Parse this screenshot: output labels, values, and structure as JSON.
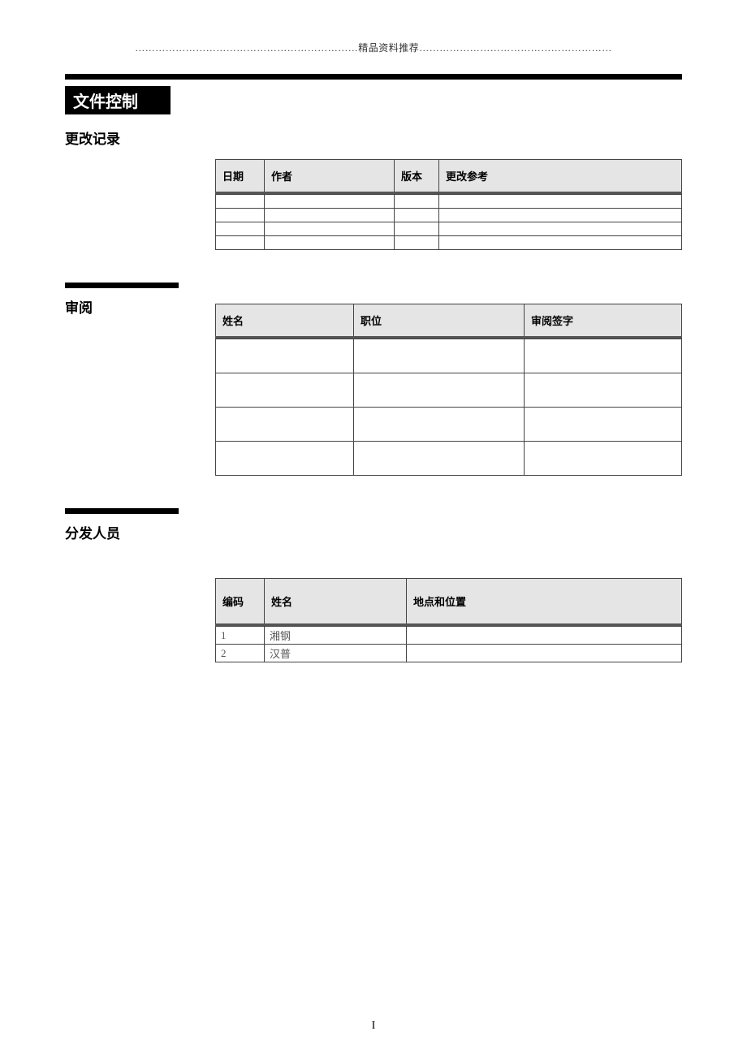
{
  "header": {
    "dotted_text": "…………………………………………………………精品资料推荐…………………………………………………"
  },
  "doc": {
    "title": "文件控制"
  },
  "change_record": {
    "heading": "更改记录",
    "columns": {
      "date": "日期",
      "author": "作者",
      "version": "版本",
      "ref": "更改参考"
    },
    "rows": [
      {
        "date": "",
        "author": "",
        "version": "",
        "ref": ""
      },
      {
        "date": "",
        "author": "",
        "version": "",
        "ref": ""
      },
      {
        "date": "",
        "author": "",
        "version": "",
        "ref": ""
      },
      {
        "date": "",
        "author": "",
        "version": "",
        "ref": ""
      }
    ]
  },
  "review": {
    "heading": "审阅",
    "columns": {
      "name": "姓名",
      "position": "职位",
      "signature": "审阅签字"
    },
    "rows": [
      {
        "name": "",
        "position": "",
        "signature": ""
      },
      {
        "name": "",
        "position": "",
        "signature": ""
      },
      {
        "name": "",
        "position": "",
        "signature": ""
      },
      {
        "name": "",
        "position": "",
        "signature": ""
      }
    ]
  },
  "distribution": {
    "heading": "分发人员",
    "columns": {
      "code": "编码",
      "name": "姓名",
      "location": "地点和位置"
    },
    "rows": [
      {
        "code": "1",
        "name": "湘钢",
        "location": ""
      },
      {
        "code": "2",
        "name": "汉普",
        "location": ""
      }
    ]
  },
  "footer": {
    "page_number": "I"
  }
}
